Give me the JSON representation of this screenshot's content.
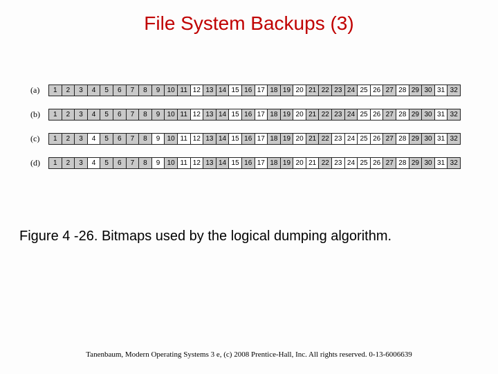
{
  "title": "File System Backups (3)",
  "rows": [
    {
      "label": "(a)",
      "cells": [
        {
          "n": "1",
          "s": 1
        },
        {
          "n": "2",
          "s": 1
        },
        {
          "n": "3",
          "s": 1
        },
        {
          "n": "4",
          "s": 1
        },
        {
          "n": "5",
          "s": 1
        },
        {
          "n": "6",
          "s": 1
        },
        {
          "n": "7",
          "s": 1
        },
        {
          "n": "8",
          "s": 1
        },
        {
          "n": "9",
          "s": 1
        },
        {
          "n": "10",
          "s": 1
        },
        {
          "n": "11",
          "s": 1
        },
        {
          "n": "12",
          "s": 0
        },
        {
          "n": "13",
          "s": 1
        },
        {
          "n": "14",
          "s": 1
        },
        {
          "n": "15",
          "s": 0
        },
        {
          "n": "16",
          "s": 1
        },
        {
          "n": "17",
          "s": 0
        },
        {
          "n": "18",
          "s": 1
        },
        {
          "n": "19",
          "s": 1
        },
        {
          "n": "20",
          "s": 0
        },
        {
          "n": "21",
          "s": 1
        },
        {
          "n": "22",
          "s": 1
        },
        {
          "n": "23",
          "s": 1
        },
        {
          "n": "24",
          "s": 1
        },
        {
          "n": "25",
          "s": 0
        },
        {
          "n": "26",
          "s": 0
        },
        {
          "n": "27",
          "s": 1
        },
        {
          "n": "28",
          "s": 0
        },
        {
          "n": "29",
          "s": 1
        },
        {
          "n": "30",
          "s": 1
        },
        {
          "n": "31",
          "s": 0
        },
        {
          "n": "32",
          "s": 1
        }
      ]
    },
    {
      "label": "(b)",
      "cells": [
        {
          "n": "1",
          "s": 1
        },
        {
          "n": "2",
          "s": 1
        },
        {
          "n": "3",
          "s": 1
        },
        {
          "n": "4",
          "s": 1
        },
        {
          "n": "5",
          "s": 1
        },
        {
          "n": "6",
          "s": 1
        },
        {
          "n": "7",
          "s": 1
        },
        {
          "n": "8",
          "s": 1
        },
        {
          "n": "9",
          "s": 1
        },
        {
          "n": "10",
          "s": 1
        },
        {
          "n": "11",
          "s": 1
        },
        {
          "n": "12",
          "s": 0
        },
        {
          "n": "13",
          "s": 1
        },
        {
          "n": "14",
          "s": 1
        },
        {
          "n": "15",
          "s": 0
        },
        {
          "n": "16",
          "s": 1
        },
        {
          "n": "17",
          "s": 0
        },
        {
          "n": "18",
          "s": 1
        },
        {
          "n": "19",
          "s": 1
        },
        {
          "n": "20",
          "s": 0
        },
        {
          "n": "21",
          "s": 1
        },
        {
          "n": "22",
          "s": 1
        },
        {
          "n": "23",
          "s": 1
        },
        {
          "n": "24",
          "s": 1
        },
        {
          "n": "25",
          "s": 0
        },
        {
          "n": "26",
          "s": 0
        },
        {
          "n": "27",
          "s": 1
        },
        {
          "n": "28",
          "s": 0
        },
        {
          "n": "29",
          "s": 1
        },
        {
          "n": "30",
          "s": 1
        },
        {
          "n": "31",
          "s": 0
        },
        {
          "n": "32",
          "s": 1
        }
      ]
    },
    {
      "label": "(c)",
      "cells": [
        {
          "n": "1",
          "s": 1
        },
        {
          "n": "2",
          "s": 1
        },
        {
          "n": "3",
          "s": 1
        },
        {
          "n": "4",
          "s": 0
        },
        {
          "n": "5",
          "s": 1
        },
        {
          "n": "6",
          "s": 1
        },
        {
          "n": "7",
          "s": 1
        },
        {
          "n": "8",
          "s": 1
        },
        {
          "n": "9",
          "s": 0
        },
        {
          "n": "10",
          "s": 1
        },
        {
          "n": "11",
          "s": 0
        },
        {
          "n": "12",
          "s": 0
        },
        {
          "n": "13",
          "s": 1
        },
        {
          "n": "14",
          "s": 1
        },
        {
          "n": "15",
          "s": 0
        },
        {
          "n": "16",
          "s": 1
        },
        {
          "n": "17",
          "s": 0
        },
        {
          "n": "18",
          "s": 1
        },
        {
          "n": "19",
          "s": 1
        },
        {
          "n": "20",
          "s": 0
        },
        {
          "n": "21",
          "s": 1
        },
        {
          "n": "22",
          "s": 1
        },
        {
          "n": "23",
          "s": 0
        },
        {
          "n": "24",
          "s": 0
        },
        {
          "n": "25",
          "s": 0
        },
        {
          "n": "26",
          "s": 0
        },
        {
          "n": "27",
          "s": 1
        },
        {
          "n": "28",
          "s": 0
        },
        {
          "n": "29",
          "s": 1
        },
        {
          "n": "30",
          "s": 1
        },
        {
          "n": "31",
          "s": 0
        },
        {
          "n": "32",
          "s": 1
        }
      ]
    },
    {
      "label": "(d)",
      "cells": [
        {
          "n": "1",
          "s": 1
        },
        {
          "n": "2",
          "s": 1
        },
        {
          "n": "3",
          "s": 1
        },
        {
          "n": "4",
          "s": 0
        },
        {
          "n": "5",
          "s": 1
        },
        {
          "n": "6",
          "s": 1
        },
        {
          "n": "7",
          "s": 1
        },
        {
          "n": "8",
          "s": 1
        },
        {
          "n": "9",
          "s": 0
        },
        {
          "n": "10",
          "s": 1
        },
        {
          "n": "11",
          "s": 0
        },
        {
          "n": "12",
          "s": 0
        },
        {
          "n": "13",
          "s": 1
        },
        {
          "n": "14",
          "s": 1
        },
        {
          "n": "15",
          "s": 0
        },
        {
          "n": "16",
          "s": 1
        },
        {
          "n": "17",
          "s": 0
        },
        {
          "n": "18",
          "s": 1
        },
        {
          "n": "19",
          "s": 1
        },
        {
          "n": "20",
          "s": 0
        },
        {
          "n": "21",
          "s": 0
        },
        {
          "n": "22",
          "s": 1
        },
        {
          "n": "23",
          "s": 0
        },
        {
          "n": "24",
          "s": 0
        },
        {
          "n": "25",
          "s": 0
        },
        {
          "n": "26",
          "s": 0
        },
        {
          "n": "27",
          "s": 1
        },
        {
          "n": "28",
          "s": 0
        },
        {
          "n": "29",
          "s": 1
        },
        {
          "n": "30",
          "s": 1
        },
        {
          "n": "31",
          "s": 0
        },
        {
          "n": "32",
          "s": 1
        }
      ]
    }
  ],
  "caption": "Figure 4 -26. Bitmaps used by the logical dumping algorithm.",
  "footer": "Tanenbaum, Modern Operating Systems 3 e, (c) 2008 Prentice-Hall, Inc. All rights reserved. 0-13-6006639"
}
